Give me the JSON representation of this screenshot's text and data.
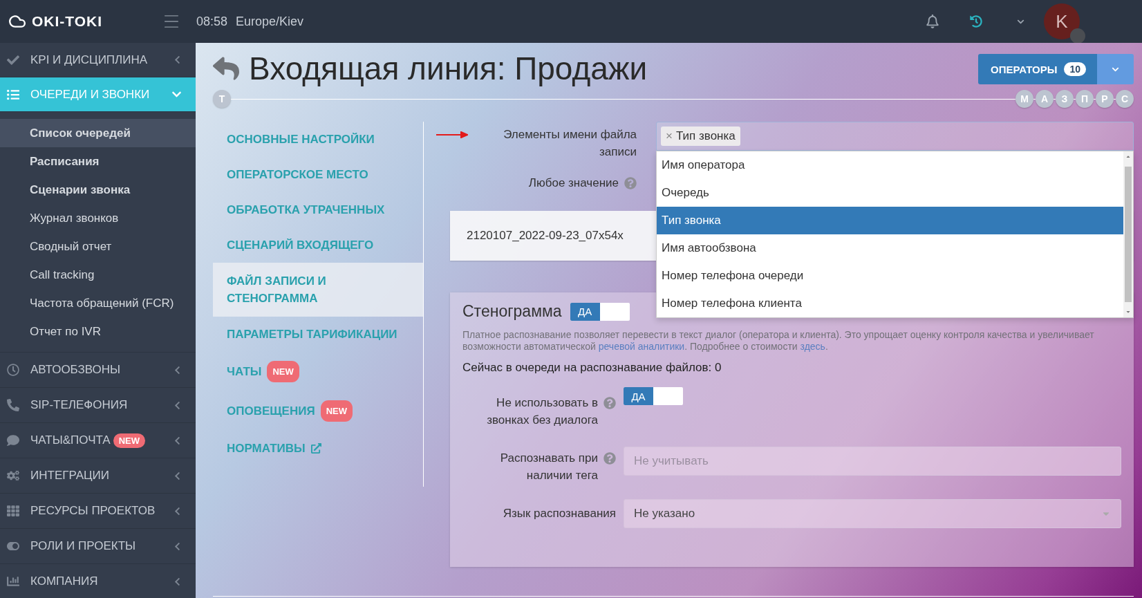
{
  "topbar": {
    "logo": "OKI-TOKI",
    "time": "08:58",
    "timezone": "Europe/Kiev",
    "avatar": "K"
  },
  "sidebar": {
    "sections": [
      {
        "label": "KPI И ДИСЦИПЛИНА",
        "selected": false,
        "expanded": false
      },
      {
        "label": "ОЧЕРЕДИ И ЗВОНКИ",
        "selected": true,
        "expanded": true,
        "children": [
          {
            "label": "Список очередей",
            "selected": true,
            "kind": "primary"
          },
          {
            "label": "Расписания",
            "selected": false,
            "kind": "primary"
          },
          {
            "label": "Сценарии звонка",
            "selected": false,
            "kind": "primary"
          },
          {
            "label": "Журнал звонков",
            "selected": false,
            "kind": "secondary"
          },
          {
            "label": "Сводный отчет",
            "selected": false,
            "kind": "secondary"
          },
          {
            "label": "Call tracking",
            "selected": false,
            "kind": "secondary"
          },
          {
            "label": "Частота обращений (FCR)",
            "selected": false,
            "kind": "secondary"
          },
          {
            "label": "Отчет по IVR",
            "selected": false,
            "kind": "secondary"
          }
        ]
      },
      {
        "label": "АВТООБЗВОНЫ",
        "selected": false,
        "expanded": false
      },
      {
        "label": "SIP-ТЕЛЕФОНИЯ",
        "selected": false,
        "expanded": false
      },
      {
        "label": "ЧАТЫ&ПОЧТА",
        "selected": false,
        "expanded": false,
        "badge": "NEW"
      },
      {
        "label": "ИНТЕГРАЦИИ",
        "selected": false,
        "expanded": false
      },
      {
        "label": "РЕСУРСЫ ПРОЕКТОВ",
        "selected": false,
        "expanded": false
      },
      {
        "label": "РОЛИ И ПРОЕКТЫ",
        "selected": false,
        "expanded": false
      },
      {
        "label": "КОМПАНИЯ",
        "selected": false,
        "expanded": false
      }
    ]
  },
  "page": {
    "title": "Входящая линия: Продажи",
    "operators": {
      "label": "ОПЕРАТОРЫ",
      "count": "10"
    },
    "timeline": {
      "start": "Т",
      "markers": [
        "М",
        "А",
        "З",
        "П",
        "Р",
        "С"
      ]
    },
    "nav": [
      {
        "label": "ОСНОВНЫЕ НАСТРОЙКИ",
        "selected": false
      },
      {
        "label": "ОПЕРАТОРСКОЕ МЕСТО",
        "selected": false
      },
      {
        "label": "ОБРАБОТКА УТРАЧЕННЫХ",
        "selected": false
      },
      {
        "label": "СЦЕНАРИЙ ВХОДЯЩЕГО",
        "selected": false
      },
      {
        "label": "ФАЙЛ ЗАПИСИ И СТЕНОГРАММА",
        "selected": true
      },
      {
        "label": "ПАРАМЕТРЫ ТАРИФИКАЦИИ",
        "selected": false
      },
      {
        "label": "ЧАТЫ",
        "selected": false,
        "badge": "NEW"
      },
      {
        "label": "ОПОВЕЩЕНИЯ",
        "selected": false,
        "badge": "NEW"
      },
      {
        "label": "НОРМАТИВЫ",
        "selected": false,
        "external": true
      }
    ],
    "filename_elements": {
      "label": "Элементы имени файла записи",
      "tags": [
        {
          "remove": "×",
          "label": "Тип звонка"
        }
      ],
      "options": [
        {
          "label": "Имя оператора",
          "selected": false
        },
        {
          "label": "Очередь",
          "selected": false
        },
        {
          "label": "Тип звонка",
          "selected": true
        },
        {
          "label": "Имя автообзвона",
          "selected": false
        },
        {
          "label": "Номер телефона очереди",
          "selected": false
        },
        {
          "label": "Номер телефона клиента",
          "selected": false
        }
      ]
    },
    "any_value": {
      "label": "Любое значение"
    },
    "filename_preview": "2120107_2022-09-23_07x54x",
    "transcript": {
      "title": "Стенограмма",
      "toggle": {
        "label": "ДА",
        "on": true
      },
      "description": [
        {
          "kind": "text",
          "text": "Платное распознавание позволяет перевести в текст диалог (оператора и клиента). Это упрощает оценку контроля качества и увеличивает возможности автоматической "
        },
        {
          "kind": "link",
          "text": "речевой аналитики"
        },
        {
          "kind": "text",
          "text": ". Подробнее о стоимости "
        },
        {
          "kind": "link",
          "text": "здесь"
        },
        {
          "kind": "text",
          "text": "."
        }
      ],
      "queue_status": "Сейчас в очереди на распознавание файлов: 0",
      "fields": [
        {
          "kind": "toggle",
          "label": "Не использовать в звонках без диалога",
          "value": "ДА",
          "on": true
        },
        {
          "kind": "input",
          "label": "Распознавать при наличии тега",
          "placeholder": "Не учитывать"
        },
        {
          "kind": "select",
          "label": "Язык распознавания",
          "value": "Не указано"
        }
      ]
    }
  }
}
